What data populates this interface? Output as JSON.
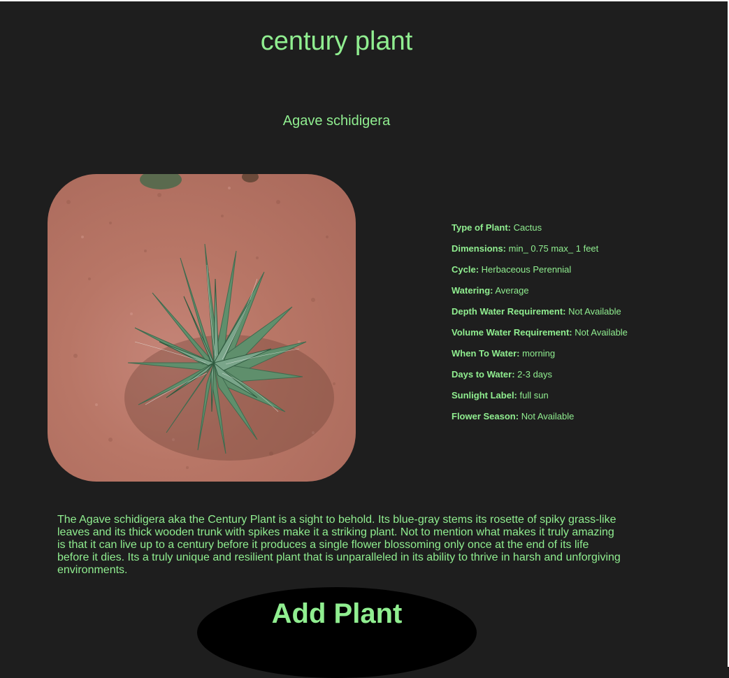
{
  "plant": {
    "common_name": "century plant",
    "scientific_name": "Agave schidigera",
    "image_alt": "Agave schidigera photo",
    "details": [
      {
        "label": "Type of Plant:",
        "value": "Cactus"
      },
      {
        "label": "Dimensions:",
        "value": "min_ 0.75 max_ 1 feet"
      },
      {
        "label": "Cycle:",
        "value": "Herbaceous Perennial"
      },
      {
        "label": "Watering:",
        "value": "Average"
      },
      {
        "label": "Depth Water Requirement:",
        "value": "Not Available"
      },
      {
        "label": "Volume Water Requirement:",
        "value": "Not Available"
      },
      {
        "label": "When To Water:",
        "value": "morning"
      },
      {
        "label": "Days to Water:",
        "value": "2-3 days"
      },
      {
        "label": "Sunlight Label:",
        "value": "full sun"
      },
      {
        "label": "Flower Season:",
        "value": "Not Available"
      }
    ],
    "description": "The Agave schidigera aka the Century Plant is a sight to behold. Its blue-gray stems its rosette of spiky grass-like leaves and its thick wooden trunk with spikes make it a striking plant. Not to mention what makes it truly amazing is that it can live up to a century before it produces a single flower blossoming only once at the end of its life before it dies. Its a truly unique and resilient plant that is unparalleled in its ability to thrive in harsh and unforgiving environments."
  },
  "actions": {
    "add_label": "Add Plant"
  },
  "colors": {
    "background": "#1e1e1e",
    "text": "#90ee90",
    "button": "#000000"
  }
}
